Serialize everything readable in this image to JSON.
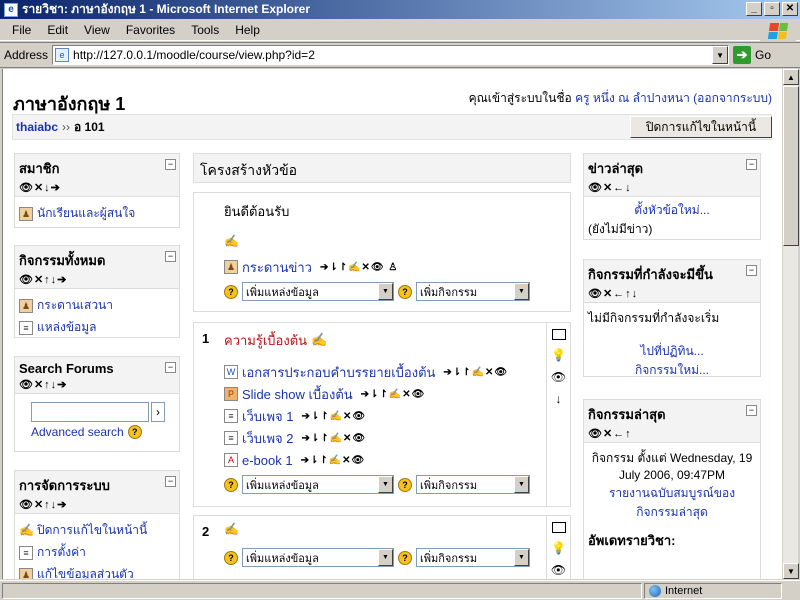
{
  "window": {
    "title": "รายวิชา: ภาษาอังกฤษ 1 - Microsoft Internet Explorer",
    "min": "_",
    "max": "▫",
    "close": "✕"
  },
  "menu": [
    "File",
    "Edit",
    "View",
    "Favorites",
    "Tools",
    "Help"
  ],
  "address": {
    "label": "Address",
    "url": "http://127.0.0.1/moodle/course/view.php?id=2",
    "go": "Go"
  },
  "status": {
    "zone": "Internet"
  },
  "course": {
    "title": "ภาษาอังกฤษ 1",
    "login_prefix": "คุณเข้าสู่ระบบในชื่อ",
    "user": "ครู หนึ่ง ณ ลำปางหนา",
    "logout": "(ออกจากระบบ)",
    "breadcrumb_home": "thaiabc",
    "breadcrumb_sep": "››",
    "breadcrumb_course": "อ 101",
    "edit_button": "ปิดการแก้ไขในหน้านี้"
  },
  "controls": {
    "move4": "👁✕↓➔",
    "move5": "👁✕↑↓➔",
    "move6": "👁✕←↑↓",
    "move_news": "👁✕←↓",
    "move_recent": "👁✕←↑"
  },
  "left_blocks": {
    "members": {
      "title": "สมาชิก",
      "item": "นักเรียนและผู้สนใจ"
    },
    "activities": {
      "title": "กิจกรรมทั้งหมด",
      "items": [
        "กระดานเสวนา",
        "แหล่งข้อมูล"
      ]
    },
    "search": {
      "title": "Search Forums",
      "button": "›",
      "advanced": "Advanced search"
    },
    "admin": {
      "title": "การจัดการระบบ",
      "items": [
        "ปิดการแก้ไขในหน้านี้",
        "การตั้งค่า",
        "แก้ไขข้อมูลส่วนตัว"
      ]
    }
  },
  "center": {
    "heading": "โครงสร้างหัวข้อ",
    "section0": {
      "welcome": "ยินดีต้อนรับ",
      "forum": "กระดานข่าว"
    },
    "add_resource": "เพิ่มแหล่งข้อมูล",
    "add_activity": "เพิ่มกิจกรรม",
    "section1": {
      "num": "1",
      "title": "ความรู้เบื้องต้น",
      "resources": [
        "เอกสารประกอบคำบรรยายเบื้องต้น",
        "Slide show เบื้องต้น",
        "เว็บเพจ 1",
        "เว็บเพจ 2",
        "e-book 1"
      ]
    },
    "section2": {
      "num": "2"
    },
    "actions_forum": "➔⇂↾✍✕👁 ♙",
    "actions_long": "➔⇂↾✍✕👁",
    "actions_short": "➔⇂↾✍✕👁"
  },
  "right_blocks": {
    "news": {
      "title": "ข่าวล่าสุด",
      "add": "ตั้งหัวข้อใหม่...",
      "none": "(ยังไม่มีข่าว)"
    },
    "upcoming": {
      "title": "กิจกรรมที่กำลังจะมีขึ้น",
      "none": "ไม่มีกิจกรรมที่กำลังจะเริ่ม",
      "calendar": "ไปที่ปฏิทิน...",
      "new_event": "กิจกรรมใหม่..."
    },
    "recent": {
      "title": "กิจกรรมล่าสุด",
      "since": "กิจกรรม ตั้งแต่ Wednesday, 19 July 2006, 09:47PM",
      "report": "รายงานฉบับสมบูรณ์ของกิจกรรมล่าสุด",
      "updates": "อัพเดทรายวิชา:"
    }
  }
}
